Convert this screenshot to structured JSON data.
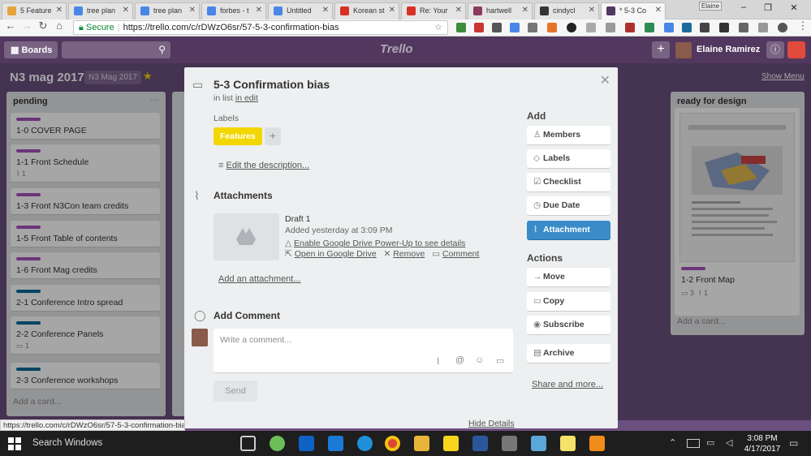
{
  "browser": {
    "tabs": [
      {
        "title": "5 Feature",
        "color": "#e8a33a"
      },
      {
        "title": "tree plan",
        "color": "#4a86e8"
      },
      {
        "title": "tree plan",
        "color": "#4a86e8"
      },
      {
        "title": "forbes - t",
        "color": "#4a86e8"
      },
      {
        "title": "Untitled",
        "color": "#4a86e8"
      },
      {
        "title": "Korean st",
        "color": "#d93025"
      },
      {
        "title": "Re: Your",
        "color": "#d93025"
      },
      {
        "title": "hartwell",
        "color": "#8b3a62"
      },
      {
        "title": "cindycl",
        "color": "#333333"
      },
      {
        "title": "* 5-3 Co",
        "color": "#52385f"
      }
    ],
    "window_user": "Elaine",
    "secure_label": "Secure",
    "url": "https://trello.com/c/rDWzO6sr/57-5-3-confirmation-bias",
    "status_url": "https://trello.com/c/rDWzO6sr/57-5-3-confirmation-bias#"
  },
  "header": {
    "boards_label": "Boards",
    "logo": "Trello",
    "user_name": "Elaine Ramirez"
  },
  "board": {
    "title": "N3 mag 2017",
    "team": "N3 Mag 2017",
    "show_menu": "Show Menu",
    "lists": [
      {
        "title": "pending",
        "cards": [
          {
            "title": "1-0 COVER PAGE",
            "label_color": "#a652bb",
            "badge": ""
          },
          {
            "title": "1-1 Front Schedule",
            "label_color": "#a652bb",
            "badge": "1"
          },
          {
            "title": "1-3 Front N3Con team credits",
            "label_color": "#a652bb",
            "badge": ""
          },
          {
            "title": "1-5 Front Table of contents",
            "label_color": "#a652bb",
            "badge": ""
          },
          {
            "title": "1-6 Front Mag credits",
            "label_color": "#a652bb",
            "badge": ""
          },
          {
            "title": "2-1 Conference Intro spread",
            "label_color": "#00699b",
            "badge": ""
          },
          {
            "title": "2-2 Conference Panels",
            "label_color": "#00699b",
            "badge": "1"
          },
          {
            "title": "2-3 Conference workshops",
            "label_color": "#00699b",
            "badge": ""
          }
        ],
        "add_card": "Add a card..."
      },
      {
        "title": "ready for design",
        "cards": [
          {
            "title": "1-2 Front Map",
            "label_color": "#a652bb",
            "comments": "3",
            "attachments": "1"
          }
        ],
        "add_card": "Add a card..."
      }
    ]
  },
  "card": {
    "title": "5-3 Confirmation bias",
    "in_list_prefix": "in list",
    "in_list": "in edit",
    "labels_heading": "Labels",
    "label": {
      "name": "Features",
      "color": "#f2d600"
    },
    "edit_description": "Edit the description...",
    "attachments_heading": "Attachments",
    "attachment": {
      "name": "Draft 1",
      "added": "Added yesterday at 3:09 PM",
      "enable_powerup": "Enable Google Drive Power-Up to see details",
      "open_drive": "Open in Google Drive",
      "remove": "Remove",
      "comment": "Comment"
    },
    "add_attachment": "Add an attachment...",
    "add_comment_heading": "Add Comment",
    "comment_placeholder": "Write a comment...",
    "send": "Send",
    "hide_details": "Hide Details"
  },
  "sidebar": {
    "add_heading": "Add",
    "add_buttons": [
      "Members",
      "Labels",
      "Checklist",
      "Due Date",
      "Attachment"
    ],
    "actions_heading": "Actions",
    "action_buttons": [
      "Move",
      "Copy",
      "Subscribe",
      "Archive"
    ],
    "share": "Share and more..."
  },
  "taskbar": {
    "search": "Search Windows",
    "time": "3:08 PM",
    "date": "4/17/2017"
  },
  "colors": {
    "accent": "#3a8cc8",
    "board": "#6b4f7f",
    "header": "#52385f"
  }
}
